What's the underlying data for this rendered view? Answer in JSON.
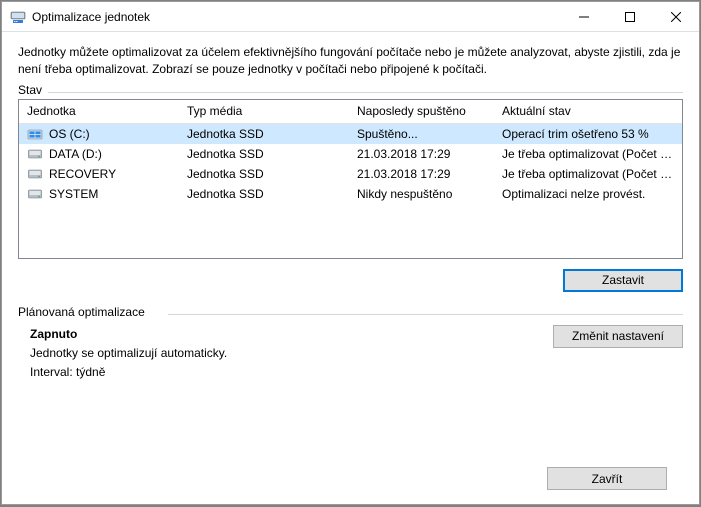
{
  "window": {
    "title": "Optimalizace jednotek"
  },
  "description": "Jednotky můžete optimalizovat za účelem efektivnějšího fungování počítače nebo je můžete analyzovat, abyste zjistili, zda je není třeba optimalizovat. Zobrazí se pouze jednotky v počítači nebo připojené k počítači.",
  "status_section_label": "Stav",
  "columns": {
    "drive": "Jednotka",
    "media": "Typ média",
    "last": "Naposledy spuštěno",
    "status": "Aktuální stav"
  },
  "rows": [
    {
      "name": "OS (C:)",
      "media": "Jednotka SSD",
      "last": "Spuštěno...",
      "status": "Operací trim ošetřeno 53 %",
      "selected": true,
      "icon": "os"
    },
    {
      "name": "DATA (D:)",
      "media": "Jednotka SSD",
      "last": "21.03.2018 17:29",
      "status": "Je třeba optimalizovat (Počet dnů od posl...",
      "selected": false,
      "icon": "hdd"
    },
    {
      "name": "RECOVERY",
      "media": "Jednotka SSD",
      "last": "21.03.2018 17:29",
      "status": "Je třeba optimalizovat (Počet dnů od posl...",
      "selected": false,
      "icon": "hdd"
    },
    {
      "name": "SYSTEM",
      "media": "Jednotka SSD",
      "last": "Nikdy nespuštěno",
      "status": "Optimalizaci nelze provést.",
      "selected": false,
      "icon": "hdd"
    }
  ],
  "buttons": {
    "stop": "Zastavit",
    "change_settings": "Změnit nastavení",
    "close": "Zavřít"
  },
  "schedule": {
    "section_label": "Plánovaná optimalizace",
    "state": "Zapnuto",
    "line1": "Jednotky se optimalizují automaticky.",
    "line2": "Interval: týdně"
  }
}
